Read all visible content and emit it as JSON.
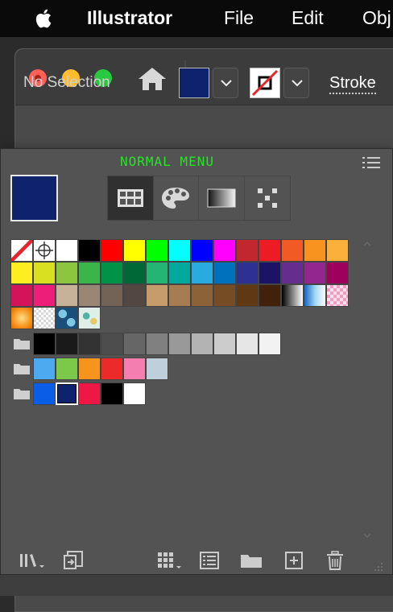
{
  "menubar": {
    "app_name": "Illustrator",
    "file": "File",
    "edit": "Edit",
    "object_partial": "Obj"
  },
  "control_bar": {
    "selection_status": "No Selection",
    "fill_color": "#0f226c",
    "stroke_label": "Stroke"
  },
  "panel": {
    "title": "NORMAL MENU",
    "current_fill": "#0f226c",
    "view_tabs": [
      {
        "name": "swatches-grid",
        "active": true
      },
      {
        "name": "color-palette",
        "active": false
      },
      {
        "name": "gradient",
        "active": false
      },
      {
        "name": "pattern",
        "active": false
      }
    ],
    "swatch_rows": [
      [
        "none",
        "registration",
        "#ffffff",
        "#000000",
        "#ff0000",
        "#ffff00",
        "#00ff00",
        "#00ffff",
        "#0000ff",
        "#ff00ff",
        "#c1272d",
        "#ed1c24",
        "#f15a24",
        "#f7931e",
        "#fbb03b"
      ],
      [
        "#fcee21",
        "#d9e021",
        "#8cc63f",
        "#39b54a",
        "#009245",
        "#006837",
        "#22b573",
        "#00a99d",
        "#29abe2",
        "#0071bc",
        "#2e3192",
        "#1b1464",
        "#662d91",
        "#93278f",
        "#9e005d"
      ],
      [
        "#d4145a",
        "#ed1e79",
        "#c7b299",
        "#998675",
        "#736357",
        "#534741",
        "#c69c6d",
        "#a67c52",
        "#8c6239",
        "#754c24",
        "#603813",
        "#42210b",
        "gradient-bw",
        "gradient-blue",
        "pattern-pink"
      ],
      [
        "gradient-orange",
        "pattern-dots",
        "pattern-blue-damask",
        "pattern-teal-floral"
      ]
    ],
    "color_groups": [
      {
        "name": "gray-group",
        "colors": [
          "#000000",
          "#1a1a1a",
          "#333333",
          "#4d4d4d",
          "#666666",
          "#808080",
          "#999999",
          "#b3b3b3",
          "#cccccc",
          "#e6e6e6",
          "#f2f2f2"
        ]
      },
      {
        "name": "bright-group",
        "colors": [
          "#4da9f0",
          "#7cc84a",
          "#f7941d",
          "#ed2a2a",
          "#f47fae",
          "#bfd0dc"
        ]
      },
      {
        "name": "document-group",
        "colors": [
          "#0a5de6",
          "#0f226c",
          "#ee1746",
          "#000000",
          "#ffffff"
        ],
        "selected_index": 1
      }
    ],
    "bottom_tools": [
      "swatch-libraries-icon",
      "place-swatches-icon",
      "show-kinds-icon",
      "swatch-options-icon",
      "new-color-group-icon",
      "new-swatch-icon",
      "delete-swatch-icon"
    ]
  }
}
